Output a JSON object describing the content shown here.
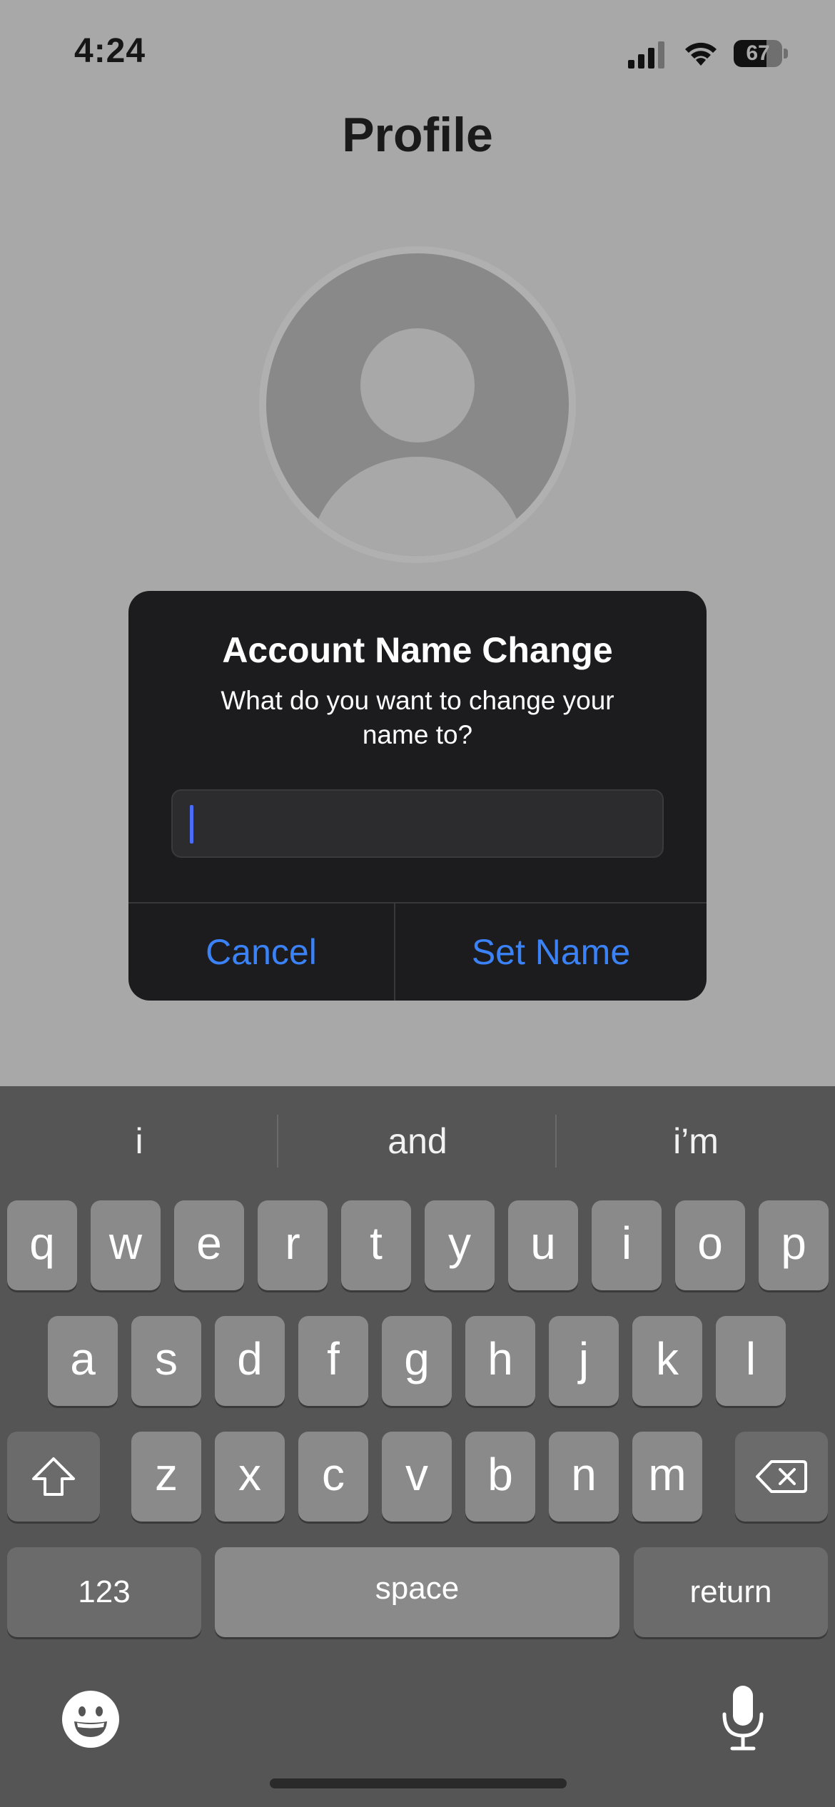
{
  "status_bar": {
    "time": "4:24",
    "battery_level": "67",
    "battery_fraction": 0.67,
    "icons": [
      "cellular-signal-icon",
      "wifi-icon",
      "battery-icon"
    ]
  },
  "page": {
    "title": "Profile",
    "avatar_icon": "person-placeholder-icon"
  },
  "alert": {
    "title": "Account Name Change",
    "message": "What do you want to change your name to?",
    "input_value": "",
    "cancel_label": "Cancel",
    "confirm_label": "Set Name",
    "accent_color": "#3b82f6"
  },
  "keyboard": {
    "suggestions": [
      "i",
      "and",
      "i’m"
    ],
    "row1": [
      "q",
      "w",
      "e",
      "r",
      "t",
      "y",
      "u",
      "i",
      "o",
      "p"
    ],
    "row2": [
      "a",
      "s",
      "d",
      "f",
      "g",
      "h",
      "j",
      "k",
      "l"
    ],
    "row3": [
      "z",
      "x",
      "c",
      "v",
      "b",
      "n",
      "m"
    ],
    "numbers_label": "123",
    "space_label": "space",
    "return_label": "return",
    "icons": [
      "shift-icon",
      "delete-icon",
      "emoji-icon",
      "microphone-icon"
    ]
  }
}
